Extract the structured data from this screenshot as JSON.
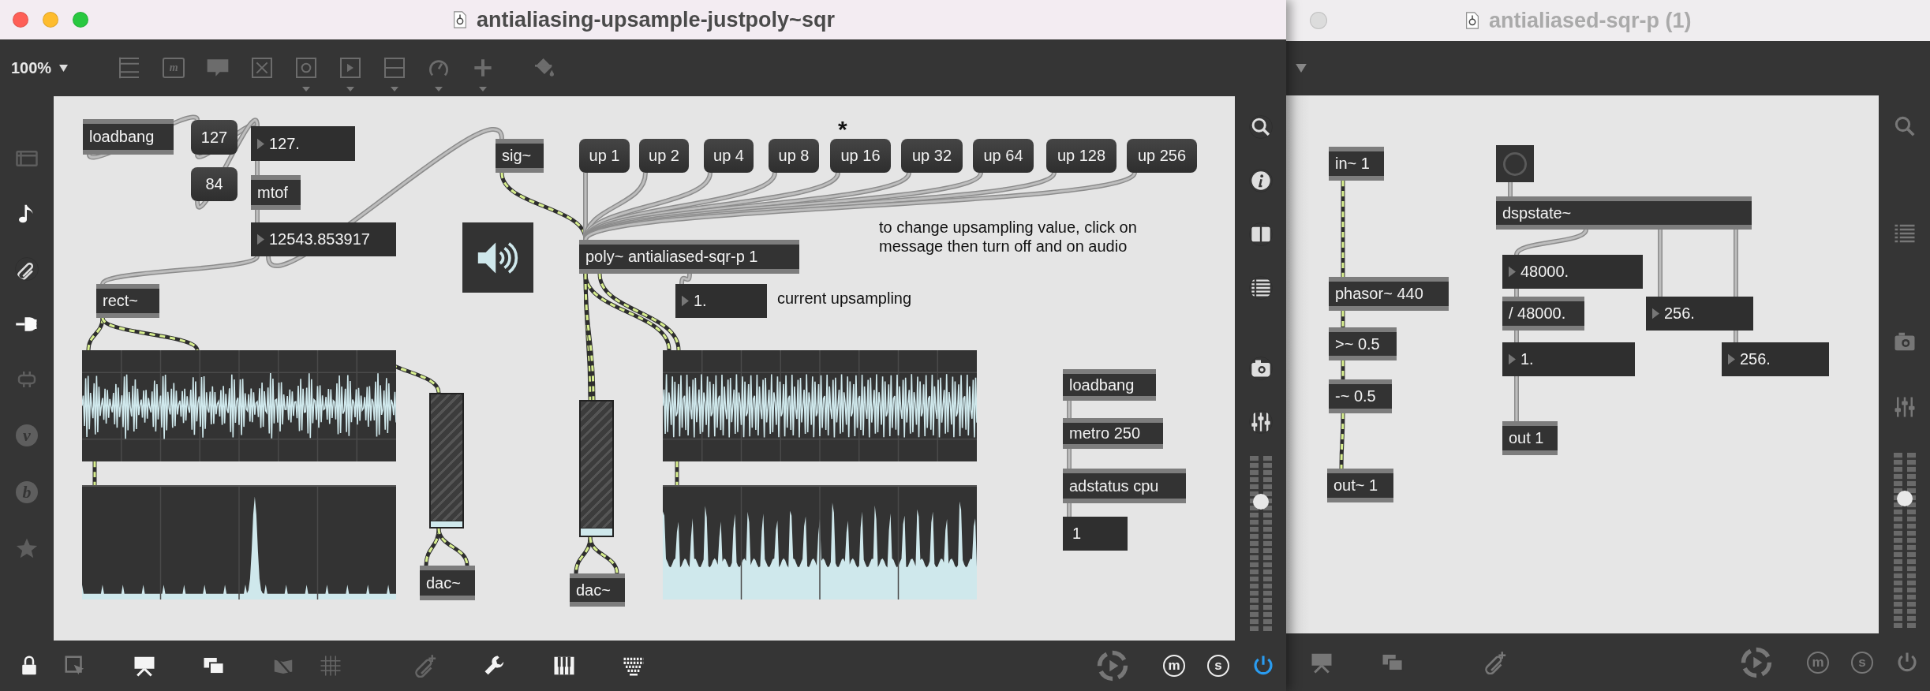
{
  "main_window": {
    "title": "antialiasing-upsample-justpoly~sqr",
    "zoom": "100%",
    "message_tool": "m",
    "sidebar_letters": [
      "v",
      "b"
    ],
    "objects": [
      {
        "kind": "object",
        "text": "loadbang"
      },
      {
        "kind": "message",
        "text": "127"
      },
      {
        "kind": "message",
        "text": "84"
      },
      {
        "kind": "number",
        "text": "127."
      },
      {
        "kind": "object",
        "text": "mtof"
      },
      {
        "kind": "number",
        "text": "12543.853917"
      },
      {
        "kind": "object",
        "text": "sig~"
      },
      {
        "kind": "ezdac"
      },
      {
        "kind": "message",
        "text": "up 1"
      },
      {
        "kind": "message",
        "text": "up 2"
      },
      {
        "kind": "message",
        "text": "up 4"
      },
      {
        "kind": "message",
        "text": "up 8"
      },
      {
        "kind": "message",
        "text": "up 16"
      },
      {
        "kind": "message",
        "text": "up 32"
      },
      {
        "kind": "message",
        "text": "up 64"
      },
      {
        "kind": "message",
        "text": "up 128"
      },
      {
        "kind": "message",
        "text": "up 256"
      },
      {
        "kind": "object",
        "text": "poly~ antialiased-sqr-p 1"
      },
      {
        "kind": "number",
        "text": "1."
      },
      {
        "kind": "object",
        "text": "rect~"
      },
      {
        "kind": "scope"
      },
      {
        "kind": "spectrum"
      },
      {
        "kind": "gain",
        "level": 0.05
      },
      {
        "kind": "object",
        "text": "dac~"
      },
      {
        "kind": "gain",
        "level": 0.06
      },
      {
        "kind": "object",
        "text": "dac~"
      },
      {
        "kind": "scope"
      },
      {
        "kind": "spectrum"
      },
      {
        "kind": "object",
        "text": "loadbang"
      },
      {
        "kind": "object",
        "text": "metro 250"
      },
      {
        "kind": "object",
        "text": "adstatus cpu"
      },
      {
        "kind": "readout",
        "text": "1"
      }
    ],
    "comments": [
      {
        "text": "*"
      },
      {
        "text": "to change upsampling value, click on\nmessage then turn off and on audio"
      },
      {
        "text": "current upsampling"
      }
    ],
    "volume": {
      "level": 0.74
    },
    "bottom_letters": [
      "m",
      "s"
    ],
    "dsp_on": true
  },
  "sub_window": {
    "title": "antialiased-sqr-p (1)",
    "objects": [
      {
        "kind": "object",
        "text": "in~ 1"
      },
      {
        "kind": "object",
        "text": "phasor~ 440"
      },
      {
        "kind": "object",
        "text": ">~ 0.5"
      },
      {
        "kind": "object",
        "text": "-~ 0.5"
      },
      {
        "kind": "object",
        "text": "out~ 1"
      },
      {
        "kind": "button"
      },
      {
        "kind": "object",
        "text": "dspstate~"
      },
      {
        "kind": "number",
        "text": "48000."
      },
      {
        "kind": "object",
        "text": "/ 48000."
      },
      {
        "kind": "number",
        "text": "256."
      },
      {
        "kind": "number",
        "text": "1."
      },
      {
        "kind": "number",
        "text": "256."
      },
      {
        "kind": "object",
        "text": "out 1"
      }
    ],
    "volume": {
      "level": 0.74
    },
    "bottom_letters": [
      "m",
      "s"
    ],
    "dsp_on": false
  }
}
